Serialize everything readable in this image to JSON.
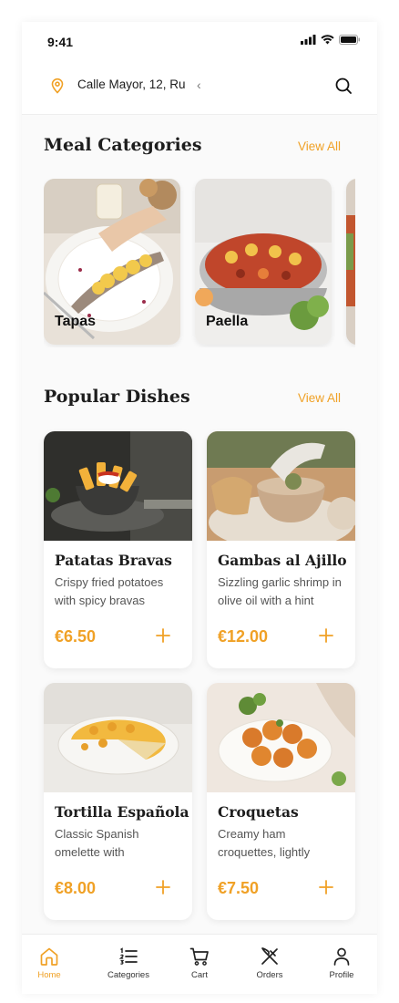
{
  "status_bar": {
    "time": "9:41"
  },
  "header": {
    "address": "Calle Mayor, 12, Ru",
    "chevron": "‹"
  },
  "categories_section": {
    "title": "Meal Categories",
    "view_all": "View All",
    "items": [
      {
        "label": "Tapas",
        "icon": "tapas-photo"
      },
      {
        "label": "Paella",
        "icon": "paella-photo"
      },
      {
        "label": "",
        "icon": "partial-photo"
      }
    ]
  },
  "popular_section": {
    "title": "Popular Dishes",
    "view_all": "View All",
    "dishes": [
      {
        "name": "Patatas Bravas",
        "description": "Crispy fried potatoes with spicy bravas",
        "price": "€6.50"
      },
      {
        "name": "Gambas al Ajillo",
        "description": "Sizzling garlic shrimp in olive oil with a hint",
        "price": "€12.00"
      },
      {
        "name": "Tortilla Española",
        "description": "Classic Spanish omelette with",
        "price": "€8.00"
      },
      {
        "name": "Croquetas",
        "description": "Creamy ham croquettes, lightly",
        "price": "€7.50"
      }
    ]
  },
  "tabbar": {
    "tabs": [
      {
        "label": "Home",
        "icon": "home-icon",
        "active": true
      },
      {
        "label": "Categories",
        "icon": "list-icon",
        "active": false
      },
      {
        "label": "Cart",
        "icon": "cart-icon",
        "active": false
      },
      {
        "label": "Orders",
        "icon": "utensils-icon",
        "active": false
      },
      {
        "label": "Profile",
        "icon": "user-icon",
        "active": false
      }
    ]
  },
  "colors": {
    "accent": "#f0a126",
    "text": "#1d1d1d",
    "muted": "#555555",
    "background": "#fafafa"
  }
}
